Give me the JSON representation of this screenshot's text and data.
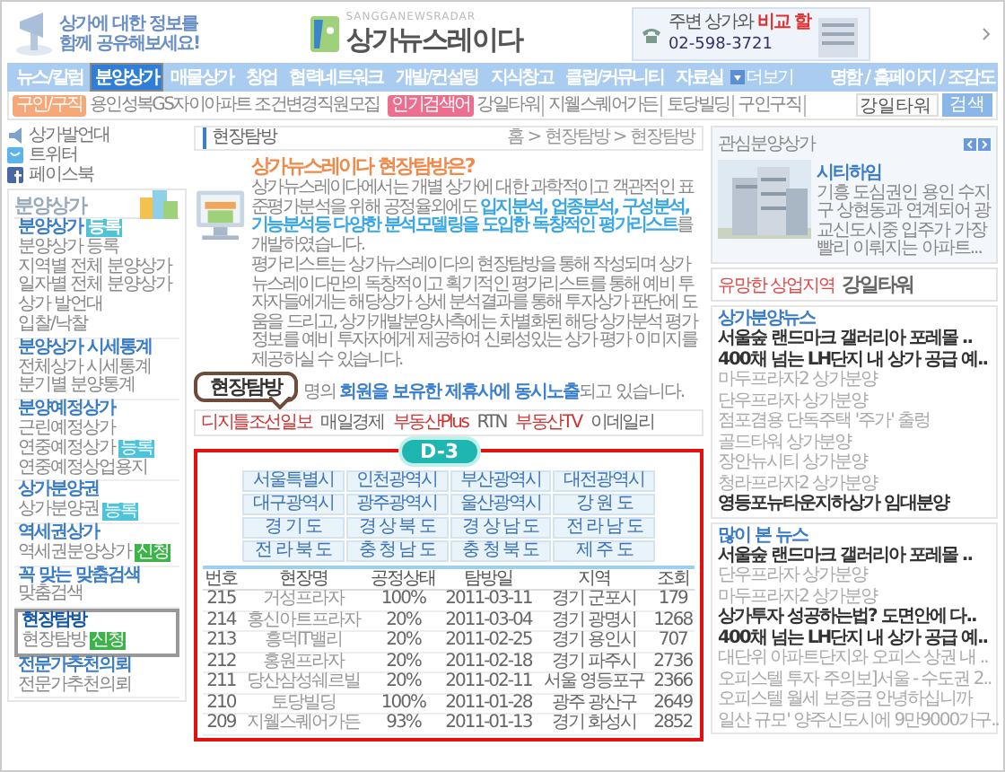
{
  "header": {
    "slogan": [
      "상가에 대한 정보를",
      "함께 공유해보세요!"
    ],
    "logo_caption": "SANGGANEWSRADAR",
    "logo": "상가뉴스레이다",
    "ad": {
      "text": "주변 상가와",
      "highlight": "비교 할",
      "phone": "02-598-3721"
    }
  },
  "nav": {
    "items": [
      {
        "label": "뉴스/칼럼",
        "selected": false
      },
      {
        "label": "분양상가",
        "selected": true
      },
      {
        "label": "매물상가",
        "selected": false
      },
      {
        "label": "창업",
        "selected": false
      },
      {
        "label": "협력네트워크",
        "selected": false
      },
      {
        "label": "개발/컨설팅",
        "selected": false
      },
      {
        "label": "지식창고",
        "selected": false
      },
      {
        "label": "클럽/커뮤니티",
        "selected": false
      },
      {
        "label": "자료실",
        "selected": false
      }
    ],
    "more": "더보기",
    "links": "명함 / 홈페이지 / 조감도"
  },
  "subbar": {
    "job_tag": "구인/구직",
    "job_text": "용인성복GS자이아파트 조건변경직원모집",
    "hot_tag": "인기검색어",
    "keywords": [
      "강일타워",
      "지웰스퀘어가든",
      "토당빌딩",
      "구인구직"
    ],
    "search": {
      "value": "강일타워",
      "button": "검색"
    }
  },
  "social": [
    {
      "label": "상가발언대",
      "kind": "speaker"
    },
    {
      "label": "트위터",
      "kind": "twitter"
    },
    {
      "label": "페이스북",
      "kind": "facebook"
    }
  ],
  "sidebar": {
    "title": "분양상가",
    "sections": [
      {
        "title": "분양상가",
        "selected": false,
        "badge": {
          "text": "등록",
          "color": "#4fc3d9"
        },
        "items": [
          {
            "label": "분양상가 등록"
          },
          {
            "label": "지역별 전체 분양상가"
          },
          {
            "label": "일자별 전체 분양상가"
          },
          {
            "label": "상가 발언대"
          },
          {
            "label": "입찰/낙찰"
          }
        ]
      },
      {
        "title": "분양상가 시세통계",
        "selected": false,
        "items": [
          {
            "label": "전체상가 시세통계"
          },
          {
            "label": "분기별 분양통계"
          }
        ]
      },
      {
        "title": "분양예정상가",
        "selected": false,
        "items": [
          {
            "label": "근린예정상가"
          },
          {
            "label": "연중예정상가",
            "badge": {
              "text": "등록",
              "color": "#4fc3d9"
            }
          },
          {
            "label": "연중예정상업용지"
          }
        ]
      },
      {
        "title": "상가분양권",
        "selected": false,
        "items": [
          {
            "label": "상가분양권",
            "badge": {
              "text": "등록",
              "color": "#4fc3d9"
            }
          }
        ]
      },
      {
        "title": "역세권상가",
        "selected": false,
        "items": [
          {
            "label": "역세권분양상가",
            "badge": {
              "text": "신청",
              "color": "#3cb44a"
            }
          }
        ]
      },
      {
        "title": "꼭 맞는 맞춤검색",
        "selected": false,
        "items": [
          {
            "label": "맞춤검색"
          }
        ]
      },
      {
        "title": "현장탐방",
        "selected": true,
        "items": [
          {
            "label": "현장탐방",
            "badge": {
              "text": "신청",
              "color": "#3cb44a"
            }
          }
        ]
      },
      {
        "title": "전문가추천의뢰",
        "selected": false,
        "items": [
          {
            "label": "전문가추천의뢰"
          }
        ]
      }
    ]
  },
  "main": {
    "title": "현장탐방",
    "breadcrumb": "홈 > 현장탐방 > 현장탐방",
    "intro_title": "상가뉴스레이다 현장탐방은?",
    "paragraphs": [
      "상가뉴스레이다에서는 개별 상가에 대한 과학적이고 객관적인 표준평가분석을 위해 공정율외에도 **입지분석, 업종분석, 구성분석, 기능분석등 다양한 분석모델링을 도입한 독창적인 평가리스트**를 개발하였습니다.",
      "평가리스트는 상가뉴스레이다의 현장탐방을 통해 작성되며 상가뉴스레이다만의 독창적이고 획기적인 평가리스트를 통해 예비 투자자들에게는 해당상가 상세 분석결과를 통해 투자상가 판단에 도움을 드리고, 상가개발분양사측에는 차별화된 해당 상가분석 평가 정보를 예비 투자자에게 제공하여 신뢰성있는 상가 평가 이미지를 제공하실 수 있습니다."
    ],
    "callout": "현장탐방",
    "closing": "명의 **회원을 보유한 제휴사에 동시노출**되고 있습니다.",
    "partners": [
      "디지틀조선일보",
      "매일경제",
      "부동산Plus",
      "RTN",
      "부동산TV",
      "이데일리"
    ],
    "badge": "D-3",
    "regions": [
      "서울특별시",
      "인천광역시",
      "부산광역시",
      "대전광역시",
      "대구광역시",
      "광주광역시",
      "울산광역시",
      "강 원 도",
      "경 기 도",
      "경 상 북 도",
      "경 상 남 도",
      "전 라 남 도",
      "전 라 북 도",
      "충 청 남 도",
      "충 청 북 도",
      "제 주 도"
    ],
    "table": {
      "columns": [
        "번호",
        "현장명",
        "공정상태",
        "탐방일",
        "지역",
        "조회"
      ],
      "rows": [
        [
          "215",
          "거성프라자",
          "100%",
          "2011-03-11",
          "경기 군포시",
          "179"
        ],
        [
          "214",
          "홍신아트프라자",
          "20%",
          "2011-03-04",
          "경기 광명시",
          "1268"
        ],
        [
          "213",
          "흥덕IT밸리",
          "20%",
          "2011-02-25",
          "경기 용인시",
          "707"
        ],
        [
          "212",
          "홍원프라자",
          "20%",
          "2011-02-18",
          "경기 파주시",
          "2736"
        ],
        [
          "211",
          "당산삼성쉐르빌",
          "20%",
          "2011-02-11",
          "서울 영등포구",
          "2366"
        ],
        [
          "210",
          "토당빌딩",
          "100%",
          "2011-01-28",
          "광주 광산구",
          "2649"
        ],
        [
          "209",
          "지웰스퀘어가든",
          "93%",
          "2011-01-13",
          "경기 화성시",
          "2852"
        ]
      ]
    }
  },
  "right": {
    "featured": {
      "title": "관심분양상가",
      "name": "시티하임",
      "text": "기흥 도심권인 용인 수지구 상현동과 연계되어 광교신도시중 입주가 가장 빨리 이뤄지는 아파트..."
    },
    "ad": {
      "tag": "유망한 상업지역",
      "name": "강일타워"
    },
    "news": [
      {
        "title": "상가분양뉴스",
        "items": [
          {
            "text": "서울숲 랜드마크 갤러리아 포레몰 ..",
            "strong": true
          },
          {
            "text": "400채 넘는 LH단지 내 상가 공급 예..",
            "strong": true
          },
          {
            "text": "마두프라자2 상가분양",
            "strong": false
          },
          {
            "text": "단우프라자 상가분양",
            "strong": false
          },
          {
            "text": "점포겸용 단독주택 '주가' 출렁",
            "strong": false
          },
          {
            "text": "골드타워 상가분양",
            "strong": false
          },
          {
            "text": "장안뉴시티 상가분양",
            "strong": false
          },
          {
            "text": "청라프라자2 상가분양",
            "strong": false
          },
          {
            "text": "영등포뉴타운지하상가 임대분양",
            "strong": true
          }
        ]
      },
      {
        "title": "많이 본 뉴스",
        "items": [
          {
            "text": "서울숲 랜드마크 갤러리아 포레몰 ..",
            "strong": true
          },
          {
            "text": "단우프라자 상가분양",
            "strong": false
          },
          {
            "text": "마두프라자2 상가분양",
            "strong": false
          },
          {
            "text": "상가투자 성공하는법? 도면안에 다..",
            "strong": true
          },
          {
            "text": "400채 넘는 LH단지 내 상가 공급 예..",
            "strong": true
          },
          {
            "text": "대단위 아파트단지와 오피스 상권 내 ..",
            "strong": false
          },
          {
            "text": "오피스텔 투자 주의보]서울 - 수도권 2..",
            "strong": false
          },
          {
            "text": "오피스텔 월세 보증금 안녕하십니까",
            "strong": false
          },
          {
            "text": "일산 규모' 양주신도시에 9만9000가구..",
            "strong": false
          }
        ]
      }
    ]
  }
}
